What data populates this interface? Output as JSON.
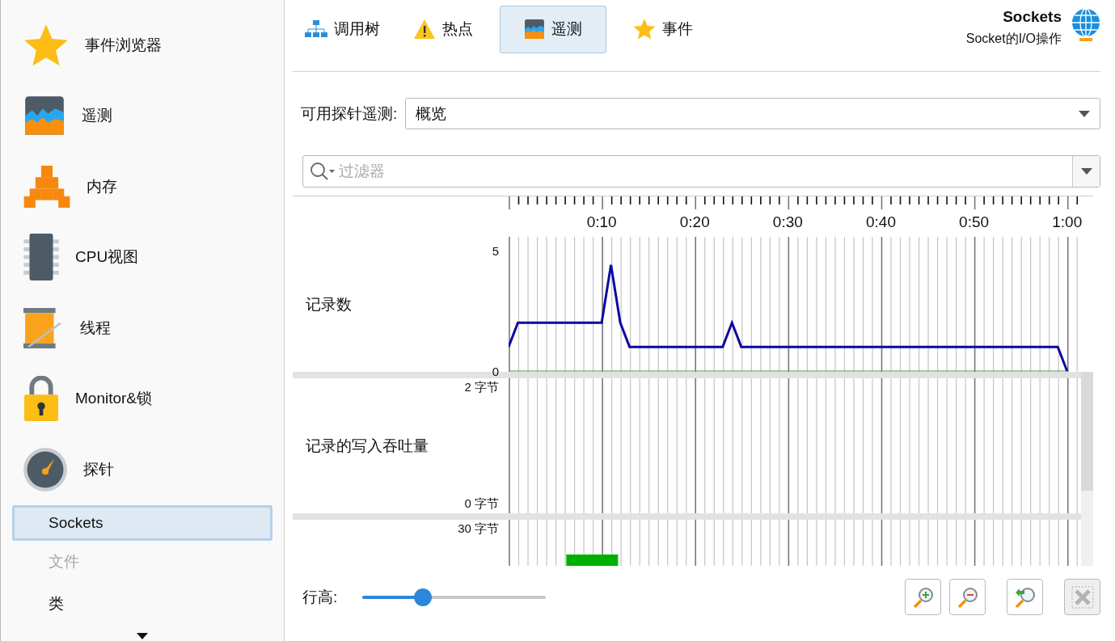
{
  "sidebar": {
    "items": [
      {
        "label": "事件浏览器",
        "kind": "star"
      },
      {
        "label": "遥测",
        "kind": "telemetry"
      },
      {
        "label": "内存",
        "kind": "cubes"
      },
      {
        "label": "CPU视图",
        "kind": "chip"
      },
      {
        "label": "线程",
        "kind": "spool"
      },
      {
        "label": "Monitor&锁",
        "kind": "lock"
      },
      {
        "label": "探针",
        "kind": "gauge"
      }
    ],
    "sub_items": [
      {
        "label": "Sockets",
        "selected": true,
        "disabled": false
      },
      {
        "label": "文件",
        "selected": false,
        "disabled": true
      },
      {
        "label": "类",
        "selected": false,
        "disabled": false
      }
    ]
  },
  "tabs": [
    {
      "label": "调用树",
      "kind": "tree",
      "selected": false
    },
    {
      "label": "热点",
      "kind": "warning",
      "selected": false
    },
    {
      "label": "遥测",
      "kind": "telemetry",
      "selected": true
    },
    {
      "label": "事件",
      "kind": "star",
      "selected": false
    }
  ],
  "header": {
    "title": "Sockets",
    "subtitle": "Socket的I/O操作"
  },
  "probe_select": {
    "label": "可用探针遥测:",
    "value": "概览"
  },
  "filter": {
    "placeholder": "过滤器"
  },
  "telemetry_rows": [
    {
      "label": "记录数",
      "kind": "line",
      "chart_data": {
        "type": "line",
        "grid": true,
        "xlim": [
          0,
          60
        ],
        "ylim": [
          0,
          5.53
        ],
        "x": [
          0,
          1,
          10,
          11,
          12,
          13,
          23,
          24,
          25,
          59,
          60
        ],
        "yticks": [
          0,
          5
        ],
        "xticks": [
          {
            "value": 10,
            "label": "0:10"
          },
          {
            "value": 20,
            "label": "0:20"
          },
          {
            "value": 30,
            "label": "0:30"
          },
          {
            "value": 40,
            "label": "0:40"
          },
          {
            "value": 50,
            "label": "0:50"
          },
          {
            "value": 60,
            "label": "1:00"
          }
        ],
        "series": [
          {
            "color": "#0a0aa0",
            "values": [
              1,
              2,
              2,
              4.4,
              2,
              1,
              1,
              2,
              1,
              1,
              0
            ]
          }
        ]
      }
    },
    {
      "label": "记录的写入吞吐量",
      "kind": "empty",
      "tick_top": "2 字节",
      "tick_bottom": "0 字节"
    },
    {
      "kind": "bars",
      "tick_top": "30 字节"
    }
  ],
  "row_height": {
    "label": "行高:",
    "level": 0.33
  },
  "tool_buttons": [
    {
      "kind": "zoom-in",
      "disabled": false
    },
    {
      "kind": "zoom-out",
      "disabled": false
    },
    {
      "kind": "zoom-reset",
      "disabled": false
    },
    {
      "kind": "clear",
      "disabled": true
    }
  ]
}
